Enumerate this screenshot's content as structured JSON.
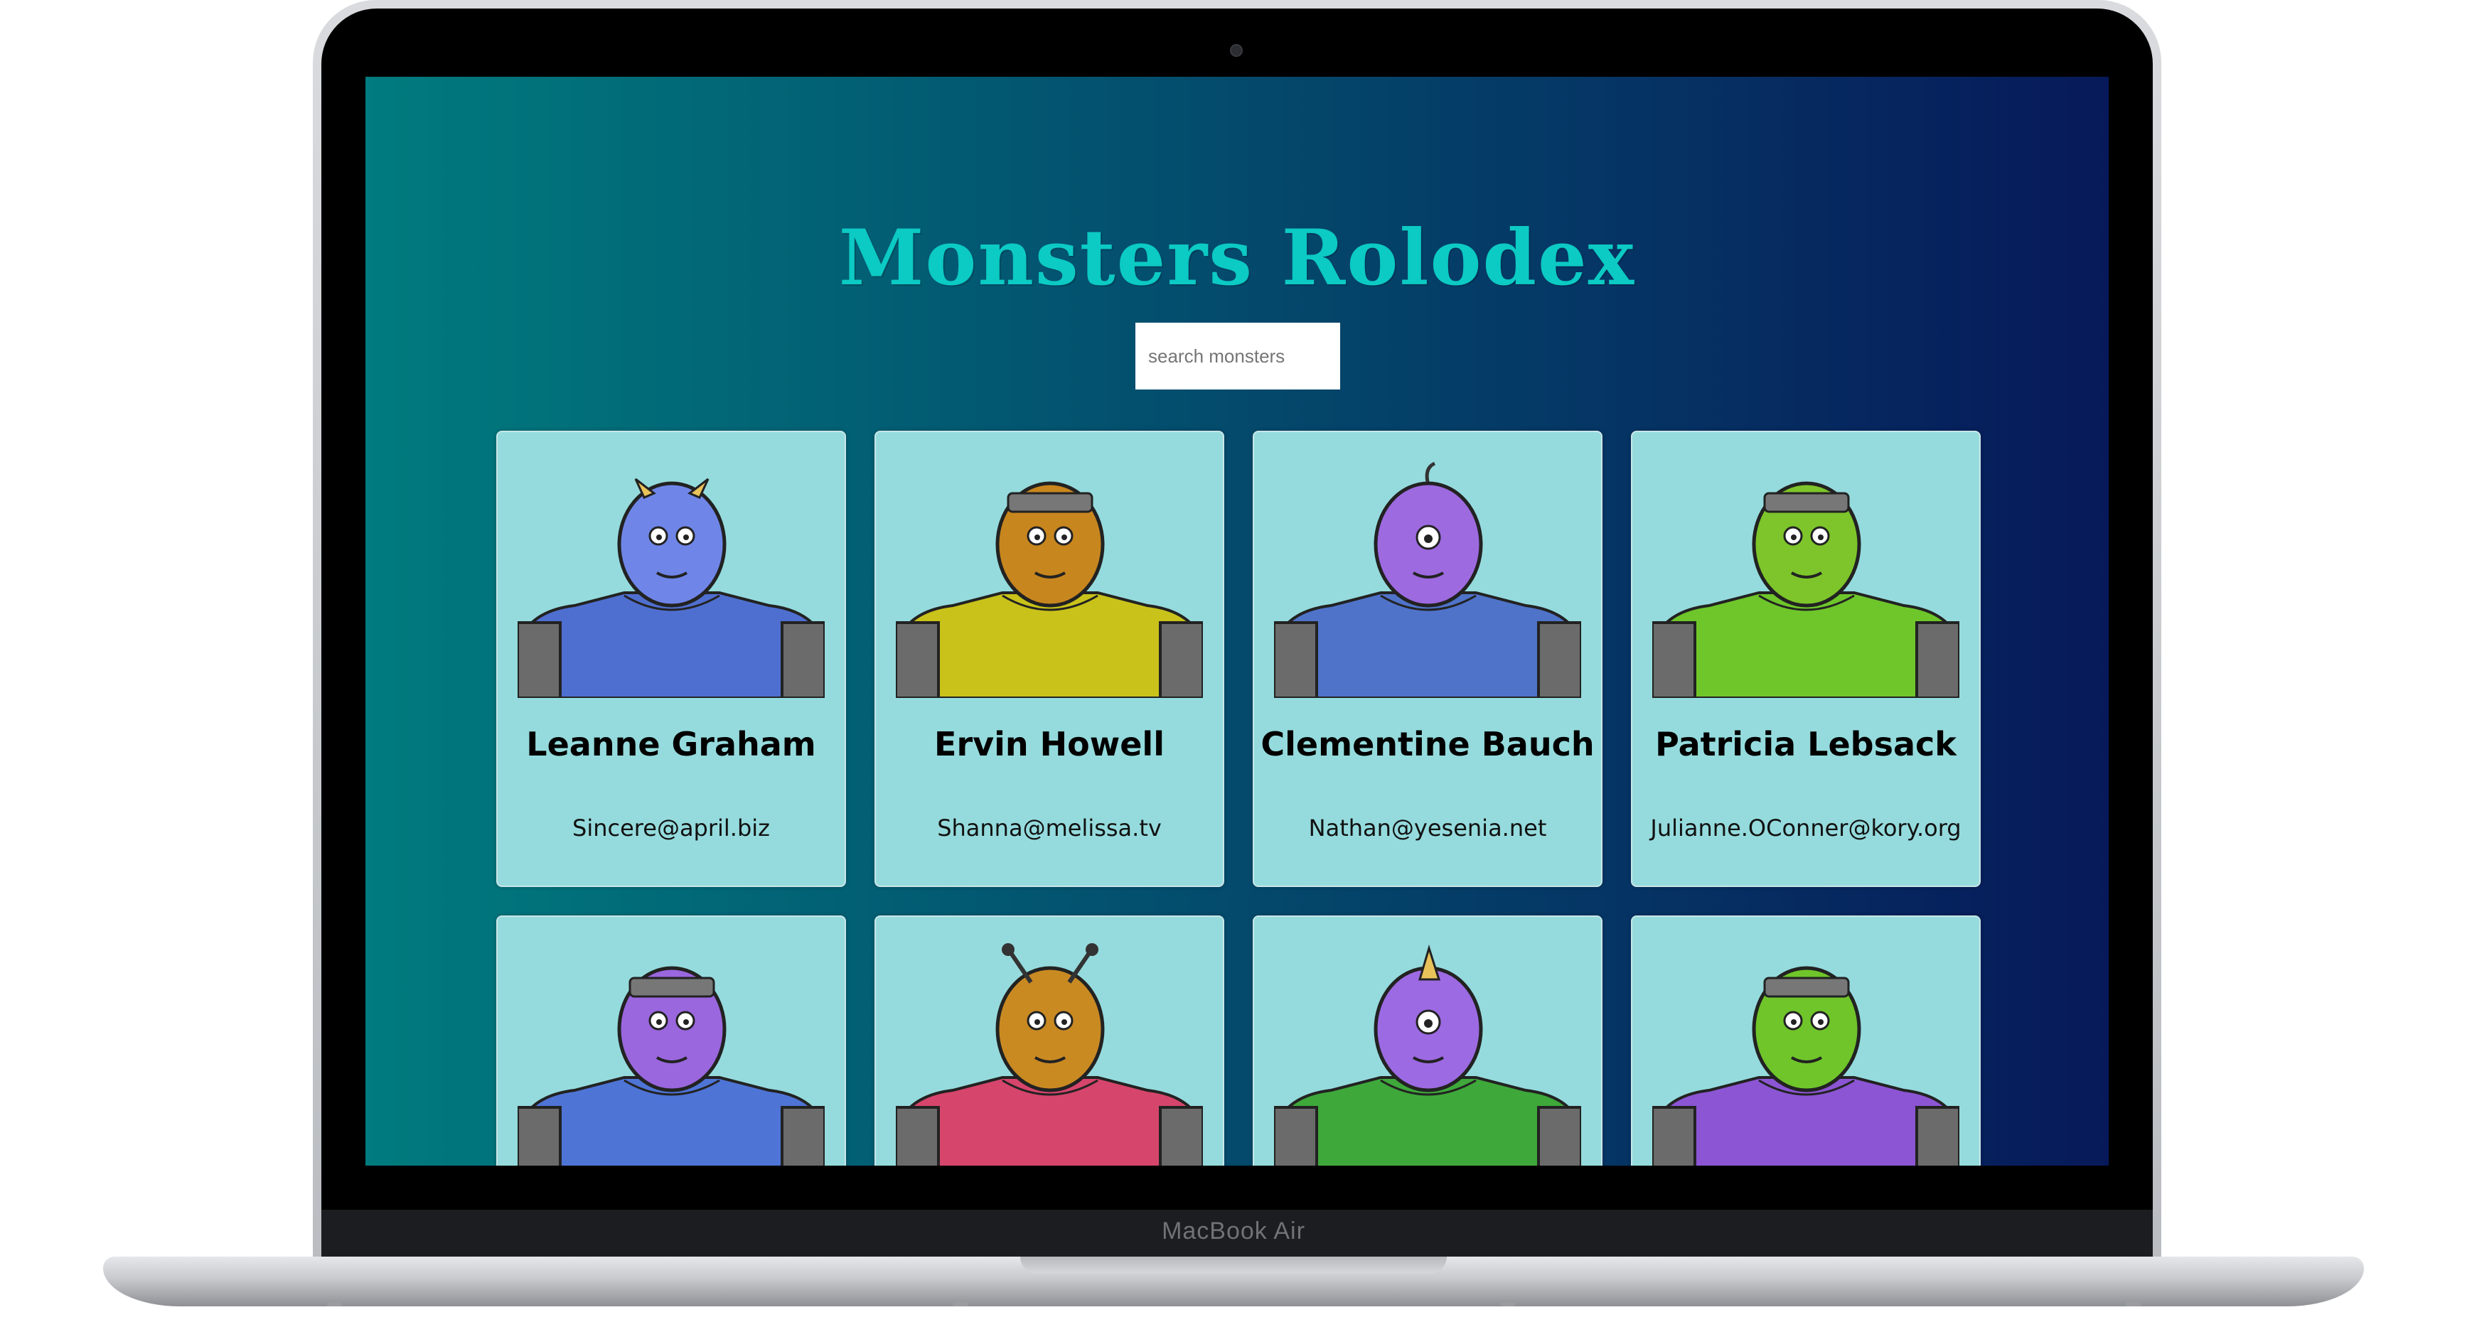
{
  "app": {
    "title": "Monsters Rolodex"
  },
  "search": {
    "placeholder": "search monsters",
    "value": ""
  },
  "device": {
    "label": "MacBook Air"
  },
  "monsters": [
    {
      "name": "Leanne Graham",
      "email": "Sincere@april.biz",
      "color": "#6f86e8",
      "body": "#4f6fd0",
      "feature": "horns"
    },
    {
      "name": "Ervin Howell",
      "email": "Shanna@melissa.tv",
      "color": "#c8861e",
      "body": "#c9c21a",
      "feature": "helmet"
    },
    {
      "name": "Clementine Bauch",
      "email": "Nathan@yesenia.net",
      "color": "#9d6ae0",
      "body": "#4f73c9",
      "feature": "cyclops"
    },
    {
      "name": "Patricia Lebsack",
      "email": "Julianne.OConner@kory.org",
      "color": "#7dc52a",
      "body": "#6ec62a",
      "feature": "dome"
    },
    {
      "name": "",
      "email": "",
      "color": "#9a67de",
      "body": "#4e74d6",
      "feature": "robot"
    },
    {
      "name": "",
      "email": "",
      "color": "#c98a22",
      "body": "#d6456c",
      "feature": "antennae"
    },
    {
      "name": "",
      "email": "",
      "color": "#9c6ae2",
      "body": "#3ea83a",
      "feature": "unihorn"
    },
    {
      "name": "",
      "email": "",
      "color": "#6fc52a",
      "body": "#8c55d4",
      "feature": "robot"
    }
  ]
}
